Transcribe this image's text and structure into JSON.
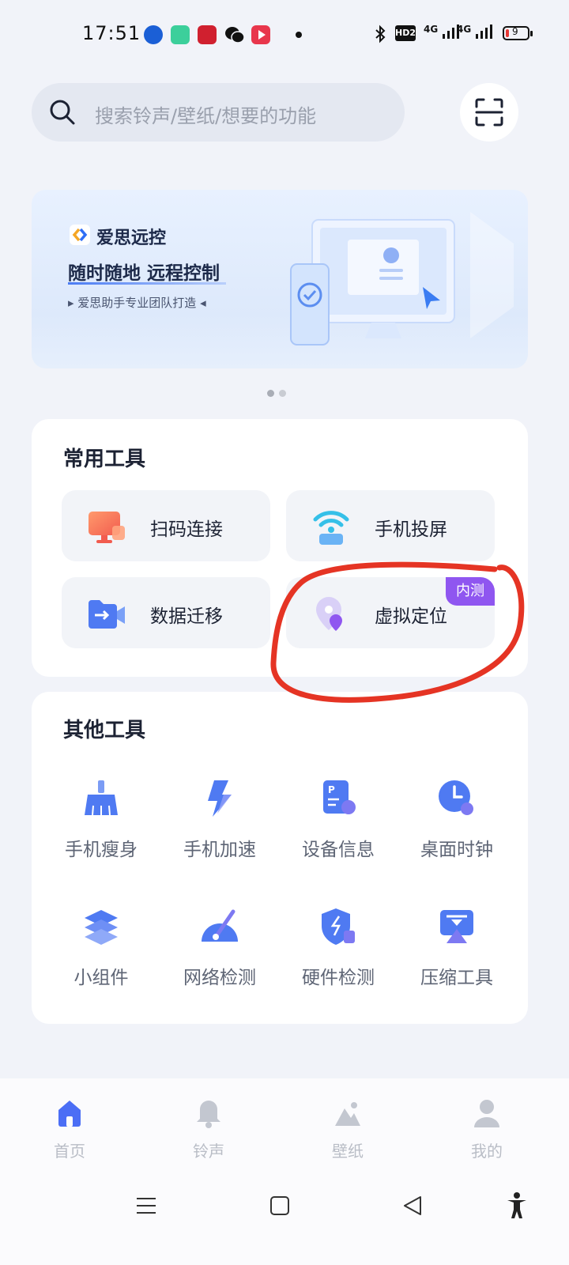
{
  "status_bar": {
    "time": "17:51",
    "hd_label": "HD2",
    "net1": "4G",
    "net2": "4G",
    "battery": "9"
  },
  "search": {
    "placeholder": "搜索铃声/壁纸/想要的功能"
  },
  "banner": {
    "brand": "爱思远控",
    "title": "随时随地 远程控制",
    "subtitle": "▸ 爱思助手专业团队打造 ◂",
    "page_count": 2,
    "active_page": 1
  },
  "common_tools": {
    "title": "常用工具",
    "items": [
      {
        "label": "扫码连接",
        "icon": "monitor-icon"
      },
      {
        "label": "手机投屏",
        "icon": "cast-icon"
      },
      {
        "label": "数据迁移",
        "icon": "video-folder-icon"
      },
      {
        "label": "虚拟定位",
        "icon": "location-pin-icon",
        "badge": "内测"
      }
    ]
  },
  "other_tools": {
    "title": "其他工具",
    "items": [
      {
        "label": "手机瘦身",
        "icon": "broom-icon"
      },
      {
        "label": "手机加速",
        "icon": "lightning-icon"
      },
      {
        "label": "设备信息",
        "icon": "device-info-icon"
      },
      {
        "label": "桌面时钟",
        "icon": "clock-icon"
      },
      {
        "label": "小组件",
        "icon": "layers-icon"
      },
      {
        "label": "网络检测",
        "icon": "speedometer-icon"
      },
      {
        "label": "硬件检测",
        "icon": "shield-icon"
      },
      {
        "label": "压缩工具",
        "icon": "compress-icon"
      }
    ]
  },
  "bottom_nav": {
    "items": [
      {
        "label": "首页",
        "icon": "home-icon",
        "active": true
      },
      {
        "label": "铃声",
        "icon": "bell-icon",
        "active": false
      },
      {
        "label": "壁纸",
        "icon": "mountain-icon",
        "active": false
      },
      {
        "label": "我的",
        "icon": "user-icon",
        "active": false
      }
    ]
  },
  "colors": {
    "accent": "#4b6ef5",
    "badge": "#8f56f0",
    "annotation": "#e53424",
    "background": "#f1f3f9"
  }
}
